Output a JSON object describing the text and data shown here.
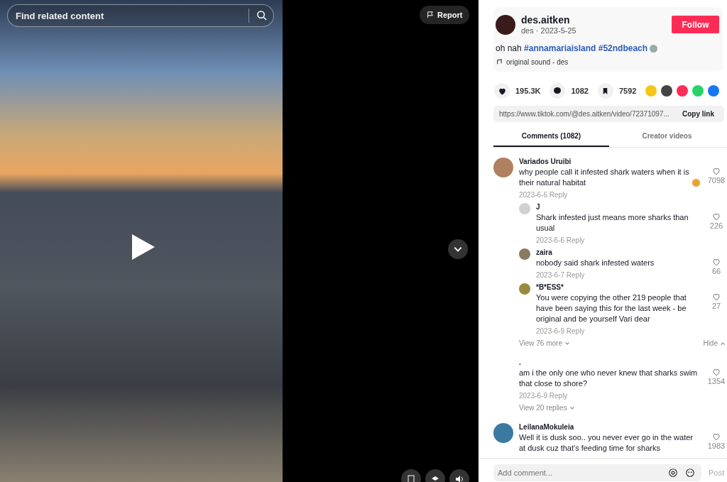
{
  "video": {
    "search": {
      "placeholder": "Find related content"
    },
    "report": "Report"
  },
  "author": {
    "username": "des.aitken",
    "subtitle": "des · 2023-5-25",
    "follow": "Follow",
    "caption": "oh nah **#annamariaisland #52ndbeach**",
    "sound": "original sound - des"
  },
  "stats": {
    "likes": "195.3K",
    "comments": "1082",
    "saves": "7592"
  },
  "link": {
    "url": "https://www.tiktok.com/@des.aitken/video/72371097...",
    "copy": "Copy link"
  },
  "tabs": [
    {
      "label": "Comments (1082)",
      "selected": true
    },
    {
      "label": "Creator videos",
      "selected": false
    }
  ],
  "comments": [
    {
      "user": "Variados Uruibi",
      "text": "why people call it infested shark waters when it is their natural habitat",
      "meta": "2023-6-6 Reply",
      "likes": "7098",
      "emoji": true,
      "color": "#b08060",
      "replies": [
        {
          "user": "J",
          "text": "Shark infested just means more sharks than usual",
          "meta": "2023-6-6 Reply",
          "likes": "226",
          "color": "#d0d0d0"
        },
        {
          "user": "zaira",
          "text": "nobody said shark infested waters",
          "meta": "2023-6-7 Reply",
          "likes": "66",
          "color": "#8a7a60"
        },
        {
          "user": "*B*ESS*",
          "text": "You were copying the other 219 people that have been saying this for the last week - be original and be yourself Vari dear",
          "meta": "2023-6-9 Reply",
          "likes": "27",
          "color": "#9a8a40"
        }
      ],
      "view_more": "View 76 more",
      "hide": "Hide"
    },
    {
      "user": ".",
      "text": "am i the only one who never knew that sharks swim that close to shore?",
      "meta": "2023-6-9 Reply",
      "likes": "1354",
      "emoji": false,
      "view_more": "View 20 replies"
    },
    {
      "user": "LeilanaMokuleia",
      "text": "Well it is dusk soo.. you never ever go in the water at dusk cuz that's feeding time for sharks",
      "likes": "1983",
      "emoji": false,
      "color": "#3a7aa0"
    }
  ],
  "composer": {
    "placeholder": "Add comment...",
    "post": "Post"
  }
}
